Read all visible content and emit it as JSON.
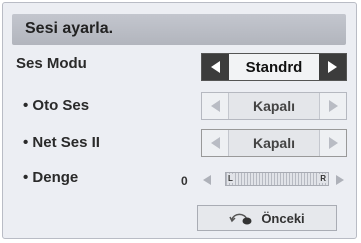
{
  "title": "Sesi ayarla.",
  "rows": {
    "sound_mode": {
      "label": "Ses Modu",
      "value": "Standrd"
    },
    "auto_volume": {
      "label": "• Oto Ses",
      "value": "Kapalı"
    },
    "clear_voice": {
      "label": "• Net Ses II",
      "value": "Kapalı"
    },
    "balance": {
      "label": "• Denge",
      "value": "0",
      "left_mark": "L",
      "right_mark": "R",
      "position": 0.5
    }
  },
  "back_button": {
    "label": "Önceki",
    "icon": "back-return-icon"
  },
  "colors": {
    "active_arrow_bg": "#3c3c3c",
    "panel_bg": "#eceef3",
    "title_bar": "#b8bbc3"
  }
}
